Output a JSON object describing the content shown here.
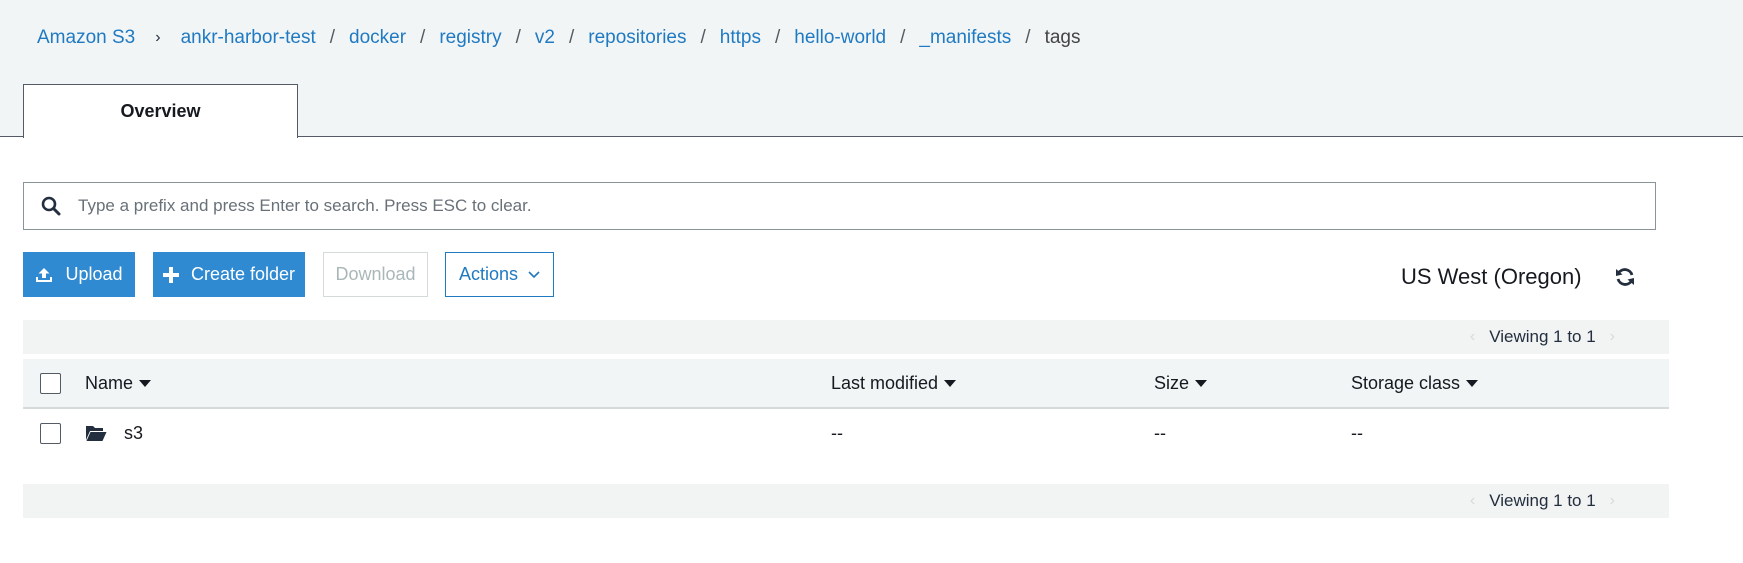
{
  "breadcrumb": {
    "root": "Amazon S3",
    "root_separator": "›",
    "separator": "/",
    "items": [
      "ankr-harbor-test",
      "docker",
      "registry",
      "v2",
      "repositories",
      "https",
      "hello-world",
      "_manifests"
    ],
    "current": "tags"
  },
  "tabs": [
    {
      "label": "Overview",
      "active": true
    }
  ],
  "search": {
    "icon": "search-icon",
    "placeholder": "Type a prefix and press Enter to search. Press ESC to clear.",
    "value": ""
  },
  "toolbar": {
    "upload_label": "Upload",
    "create_folder_label": "Create folder",
    "download_label": "Download",
    "actions_label": "Actions"
  },
  "region": "US West (Oregon)",
  "pagination": {
    "top": "Viewing 1 to 1",
    "bottom": "Viewing 1 to 1"
  },
  "table": {
    "columns": [
      "Name",
      "Last modified",
      "Size",
      "Storage class"
    ],
    "rows": [
      {
        "type": "folder",
        "name": "s3",
        "last_modified": "--",
        "size": "--",
        "storage_class": "--"
      }
    ]
  },
  "colors": {
    "accent": "#2f8ad2",
    "link": "#1f7ac2",
    "header_band": "#f2f5f6"
  }
}
